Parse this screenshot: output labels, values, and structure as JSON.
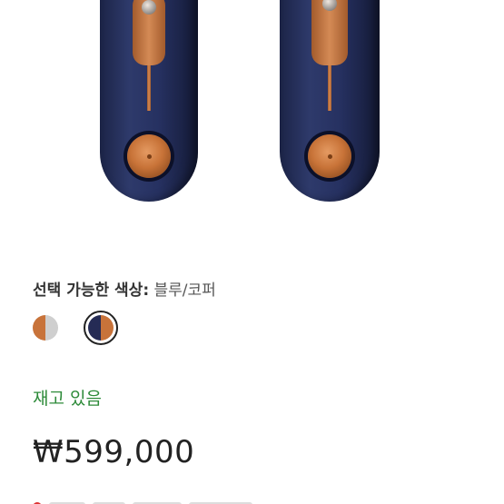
{
  "product": {
    "color_label": "선택 가능한 색상:",
    "color_value": "블루/코퍼",
    "swatches": [
      {
        "name": "copper-nickel",
        "colors": [
          "#c8733a",
          "#cfcfcf"
        ],
        "selected": false
      },
      {
        "name": "blue-copper",
        "colors": [
          "#252b55",
          "#c8733a"
        ],
        "selected": true
      }
    ],
    "stock_status": "재고 있음",
    "stock_color": "#2e8b3a",
    "price": "₩599,000"
  }
}
